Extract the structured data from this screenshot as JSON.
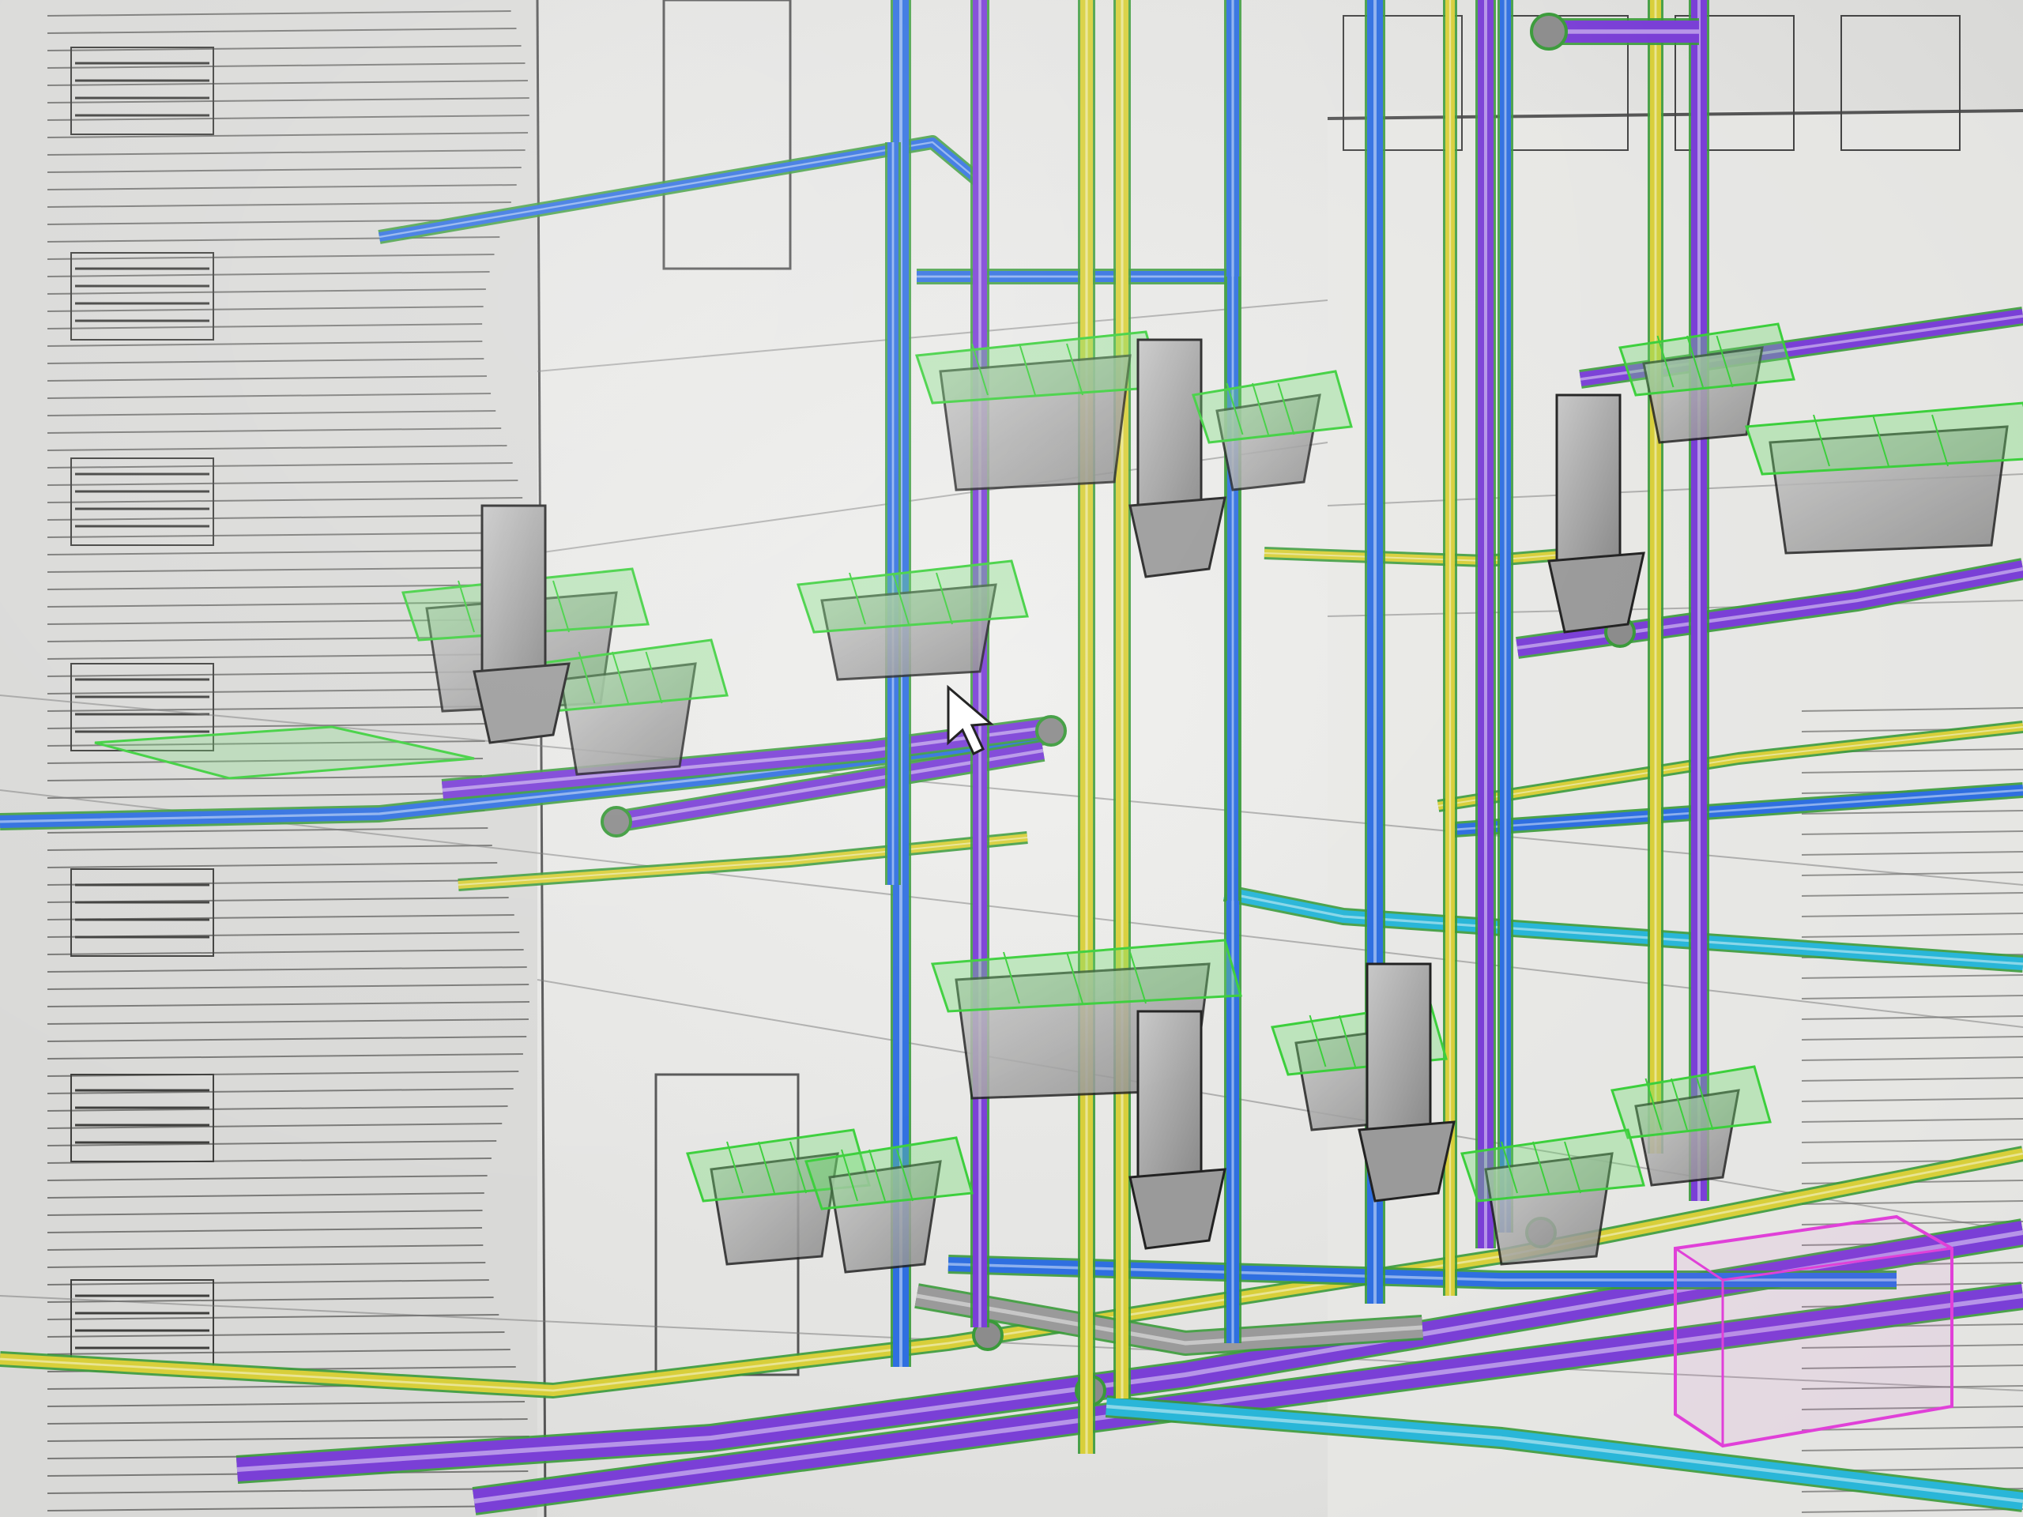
{
  "colors": {
    "background": "#e4e4e2",
    "building_lines": "#5a5a58",
    "cold_water": "#2f6fe0",
    "hot_water": "#d8cf3a",
    "waste_pipe": "#7a3fd6",
    "vent_pipe": "#29b6d8",
    "fitting_gray": "#8c8c8c",
    "fixture_outline": "#3ccf3c",
    "equipment_box": "#e040d8"
  },
  "icons": {
    "cursor": "arrow-cursor-icon"
  },
  "legend_visible": false,
  "ui_text_visible": false
}
